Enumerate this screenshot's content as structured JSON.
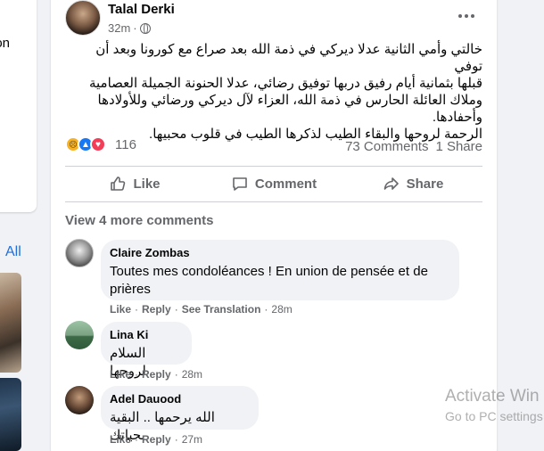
{
  "left": {
    "fragment_text": "on",
    "see_all": "All"
  },
  "post": {
    "author": "Talal Derki",
    "time": "32m",
    "text_lines": [
      "خالتي وأمي الثانية عدلا ديركي في ذمة الله بعد صراع مع كورونا وبعد أن توفي",
      "قبلها بثمانية أيام رفيق دربها توفيق رضائي، عدلا الحنونة الجميلة العصامية",
      "وملاك العائلة الحارس في ذمة الله، العزاء لآل ديركي ورضائي وللأولادها",
      "وأحفادها.",
      "الرحمة لروحها والبقاء الطيب لذكرها الطيب في قلوب محبيها."
    ],
    "reaction_count": "116",
    "comments_count": "73 Comments",
    "shares_count": "1 Share",
    "actions": {
      "like": "Like",
      "comment": "Comment",
      "share": "Share"
    },
    "view_more": "View 4 more comments"
  },
  "comments": [
    {
      "name": "Claire Zombas",
      "text": "Toutes mes condoléances ! En union de pensée et de prières",
      "like": "Like",
      "reply": "Reply",
      "translate": "See Translation",
      "time": "28m"
    },
    {
      "name": "Lina Ki",
      "text": "السلام لروحها",
      "like": "Like",
      "reply": "Reply",
      "time": "28m"
    },
    {
      "name": "Adel Dauood",
      "text": "الله يرحمها .. البقية بحياتك",
      "like": "Like",
      "reply": "Reply",
      "time": "27m"
    }
  ],
  "watermark": {
    "line1": "Activate Win",
    "line2": "Go to PC settings"
  },
  "colors": {
    "link": "#216fdb",
    "secondary_text": "#65676b",
    "like_blue": "#1877f2",
    "love_red": "#f33e58",
    "sad_yellow": "#f7b125"
  }
}
